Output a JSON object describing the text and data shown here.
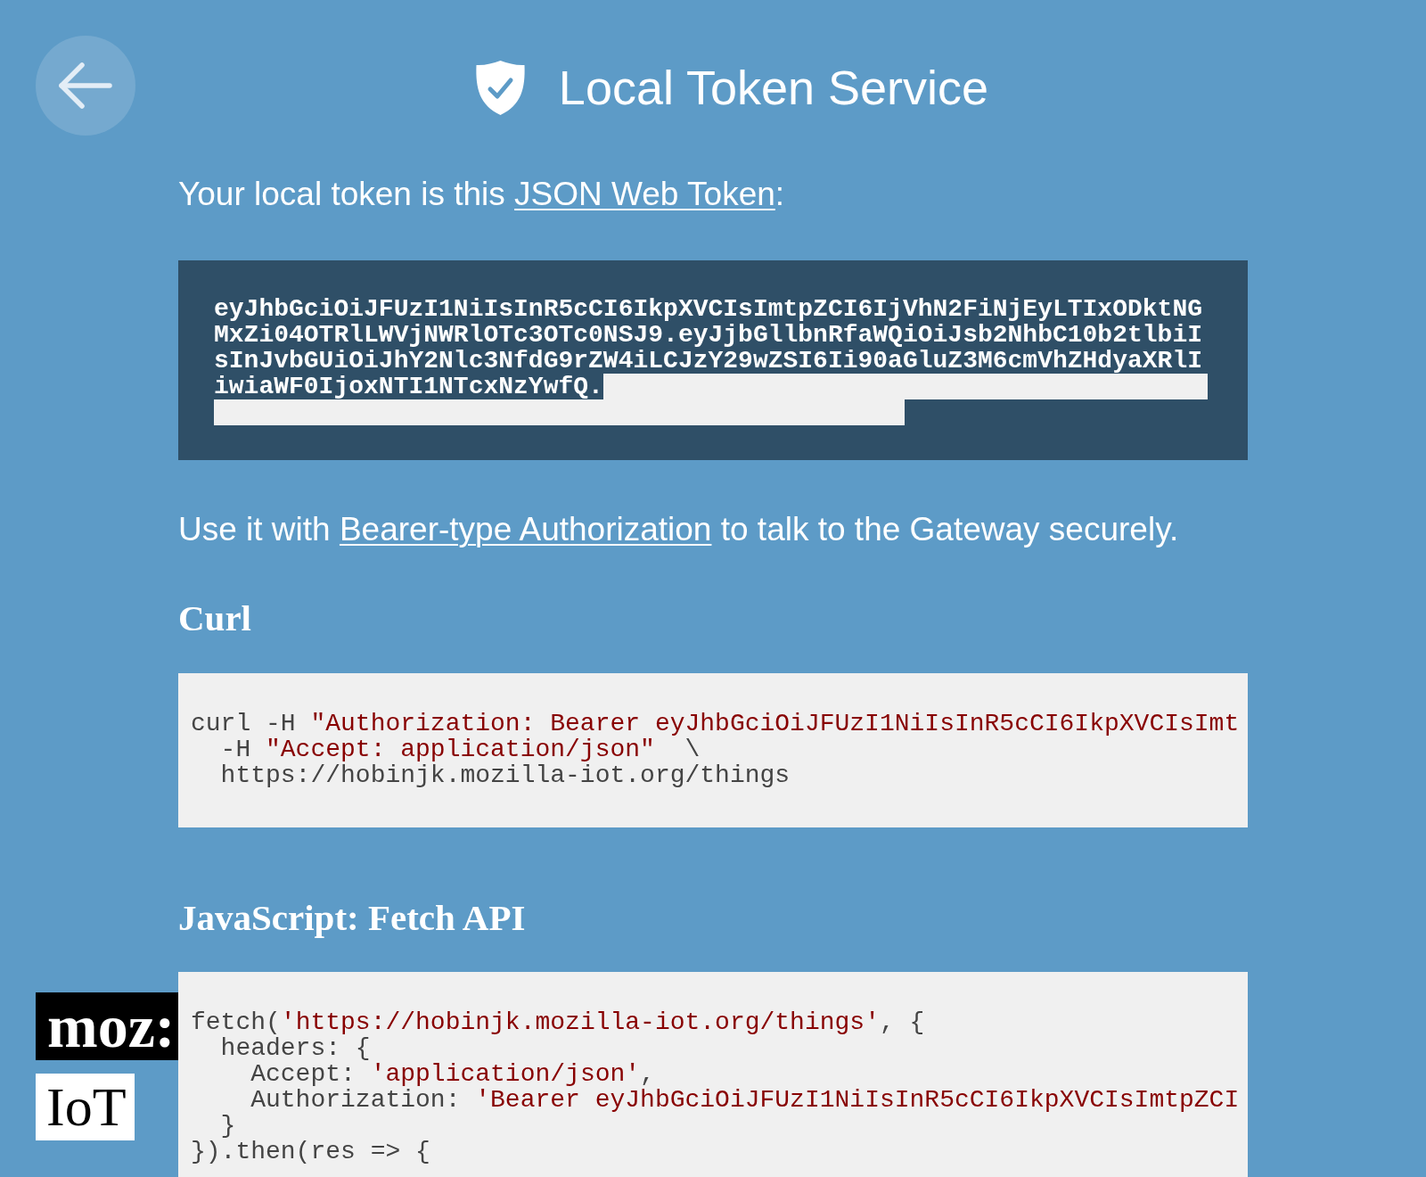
{
  "header": {
    "title": "Local Token Service"
  },
  "intro": {
    "segments": [
      {
        "kind": "text",
        "text": "Your local token is this "
      },
      {
        "kind": "link",
        "text": "JSON Web Token"
      },
      {
        "kind": "text",
        "text": ":"
      }
    ]
  },
  "token": {
    "lines": [
      "eyJhbGciOiJFUzI1NiIsInR5cCI6IkpXVCIsImtpZCI6IjVhN2FiNjEyLTIxODktNG",
      "MxZi04OTRlLWVjNWRlOTc3OTc0NSJ9.eyJjbGllbnRfaWQiOiJsb2NhbC10b2tlbiI",
      "sInJvbGUiOiJhY2Nlc3NfdG9rZW4iLCJzY29wZSI6Ii90aGluZ3M6cmVhZHdyaXRlI",
      "iwiaWF0IjoxNTI1NTcxNzYwfQ."
    ],
    "selection_highlight": true
  },
  "usage": {
    "segments": [
      {
        "kind": "text",
        "text": "Use it with "
      },
      {
        "kind": "link",
        "text": "Bearer-type Authorization"
      },
      {
        "kind": "text",
        "text": " to talk to the Gateway securely."
      }
    ]
  },
  "sections": [
    {
      "heading": "Curl",
      "code_lines": [
        {
          "segments": [
            {
              "kind": "plain",
              "text": "curl -H "
            },
            {
              "kind": "string",
              "text": "\"Authorization: Bearer eyJhbGciOiJFUzI1NiIsInR5cCI6IkpXVCIsImt"
            }
          ]
        },
        {
          "segments": [
            {
              "kind": "plain",
              "text": "  -H "
            },
            {
              "kind": "string",
              "text": "\"Accept: application/json\""
            },
            {
              "kind": "plain",
              "text": "  \\"
            }
          ]
        },
        {
          "segments": [
            {
              "kind": "plain",
              "text": "  https://hobinjk.mozilla-iot.org/things"
            }
          ]
        }
      ]
    },
    {
      "heading": "JavaScript: Fetch API",
      "code_lines": [
        {
          "segments": [
            {
              "kind": "plain",
              "text": "fetch("
            },
            {
              "kind": "string",
              "text": "'https://hobinjk.mozilla-iot.org/things'"
            },
            {
              "kind": "plain",
              "text": ", {"
            }
          ]
        },
        {
          "segments": [
            {
              "kind": "plain",
              "text": "  headers: {"
            }
          ]
        },
        {
          "segments": [
            {
              "kind": "plain",
              "text": "    Accept: "
            },
            {
              "kind": "string",
              "text": "'application/json'"
            },
            {
              "kind": "plain",
              "text": ","
            }
          ]
        },
        {
          "segments": [
            {
              "kind": "plain",
              "text": "    Authorization: "
            },
            {
              "kind": "string",
              "text": "'Bearer eyJhbGciOiJFUzI1NiIsInR5cCI6IkpXVCIsImtpZCI"
            }
          ]
        },
        {
          "segments": [
            {
              "kind": "plain",
              "text": "  }"
            }
          ]
        },
        {
          "segments": [
            {
              "kind": "plain",
              "text": "}).then(res => {"
            }
          ]
        }
      ]
    }
  ],
  "logo": {
    "wordmark": "moz:",
    "label": "IoT"
  }
}
